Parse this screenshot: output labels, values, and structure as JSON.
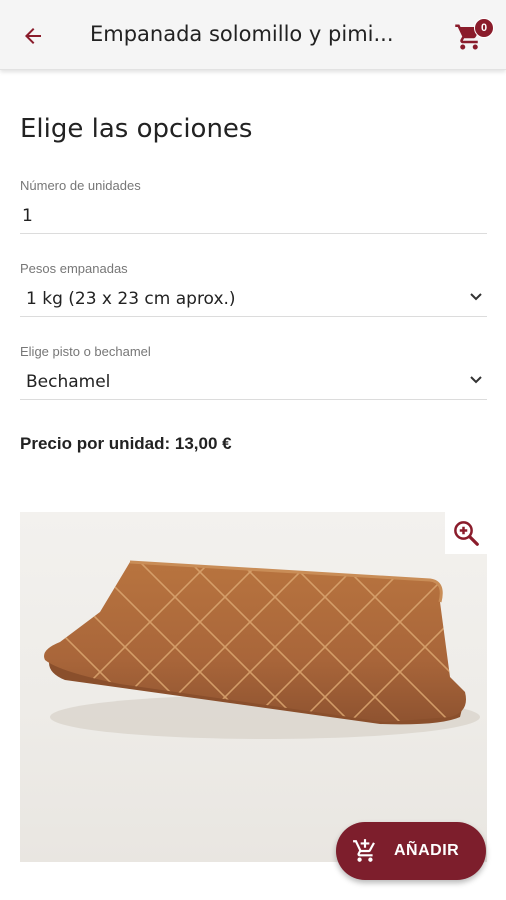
{
  "appbar": {
    "title": "Empanada solomillo y pimi...",
    "cart_count": "0"
  },
  "options": {
    "heading": "Elige las opciones",
    "fields": [
      {
        "label": "Número de unidades",
        "value": "1"
      },
      {
        "label": "Pesos empanadas",
        "value": "1 kg (23 x 23 cm aprox.)"
      },
      {
        "label": "Elige pisto o bechamel",
        "value": "Bechamel"
      }
    ]
  },
  "price": {
    "text": "Precio por unidad: 13,00 €"
  },
  "add_button": {
    "label": "AÑADIR"
  },
  "colors": {
    "accent": "#8a1c2b",
    "button": "#7d1e2c"
  }
}
